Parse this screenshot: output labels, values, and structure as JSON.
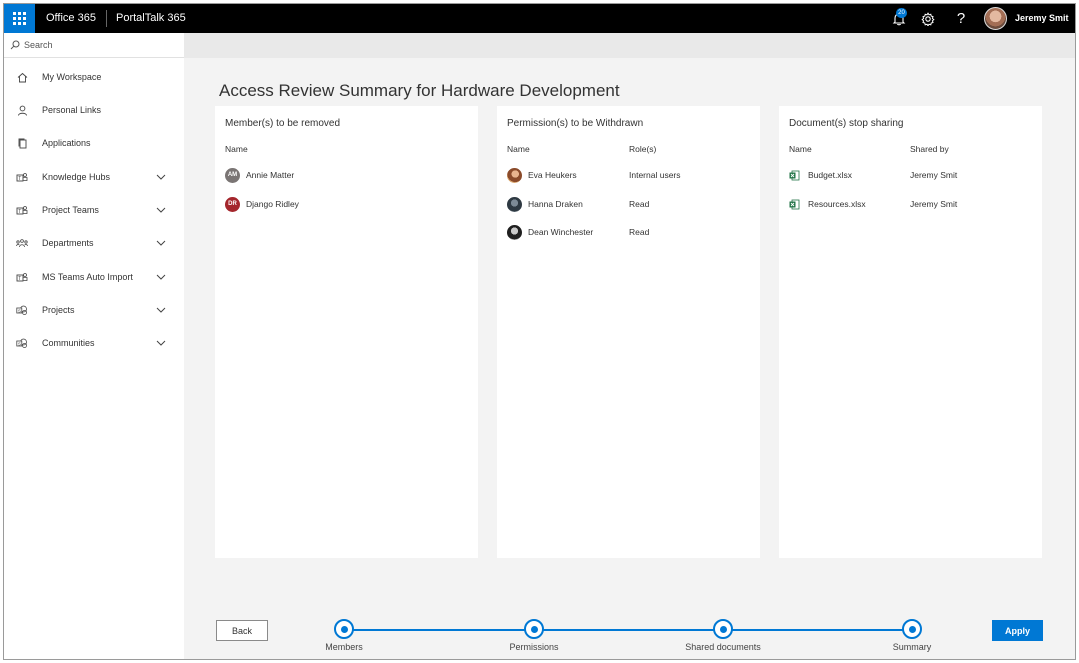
{
  "topbar": {
    "brand": "Office 365",
    "app_name": "PortalTalk 365",
    "notification_count": "20",
    "help_label": "?",
    "user_name": "Jeremy Smit"
  },
  "sidebar": {
    "search_placeholder": "Search",
    "items": [
      {
        "label": "My Workspace",
        "icon": "home-icon",
        "expandable": false
      },
      {
        "label": "Personal Links",
        "icon": "person-icon",
        "expandable": false
      },
      {
        "label": "Applications",
        "icon": "copy-icon",
        "expandable": false
      },
      {
        "label": "Knowledge Hubs",
        "icon": "teams-icon",
        "expandable": true
      },
      {
        "label": "Project Teams",
        "icon": "teams-icon",
        "expandable": true
      },
      {
        "label": "Departments",
        "icon": "org-icon",
        "expandable": true
      },
      {
        "label": "MS Teams Auto Import",
        "icon": "teams-icon",
        "expandable": true
      },
      {
        "label": "Projects",
        "icon": "sharepoint-icon",
        "expandable": true
      },
      {
        "label": "Communities",
        "icon": "sharepoint-icon",
        "expandable": true
      }
    ]
  },
  "main": {
    "title": "Access Review Summary for Hardware Development",
    "members_panel": {
      "title": "Member(s) to be removed",
      "col_name": "Name",
      "rows": [
        {
          "name": "Annie Matter",
          "initials": "AM",
          "color": "#7a7574"
        },
        {
          "name": "Django Ridley",
          "initials": "DR",
          "color": "#a4262c"
        }
      ]
    },
    "permissions_panel": {
      "title": "Permission(s) to be Withdrawn",
      "col_name": "Name",
      "col_role": "Role(s)",
      "rows": [
        {
          "name": "Eva Heukers",
          "role": "Internal users"
        },
        {
          "name": "Hanna Draken",
          "role": "Read"
        },
        {
          "name": "Dean Winchester",
          "role": "Read"
        }
      ]
    },
    "documents_panel": {
      "title": "Document(s) stop sharing",
      "col_name": "Name",
      "col_shared_by": "Shared by",
      "rows": [
        {
          "name": "Budget.xlsx",
          "shared_by": "Jeremy Smit"
        },
        {
          "name": "Resources.xlsx",
          "shared_by": "Jeremy Smit"
        }
      ]
    }
  },
  "footer": {
    "back_label": "Back",
    "apply_label": "Apply",
    "steps": [
      "Members",
      "Permissions",
      "Shared documents",
      "Summary"
    ]
  },
  "colors": {
    "accent": "#0078d4",
    "excel": "#217346"
  }
}
